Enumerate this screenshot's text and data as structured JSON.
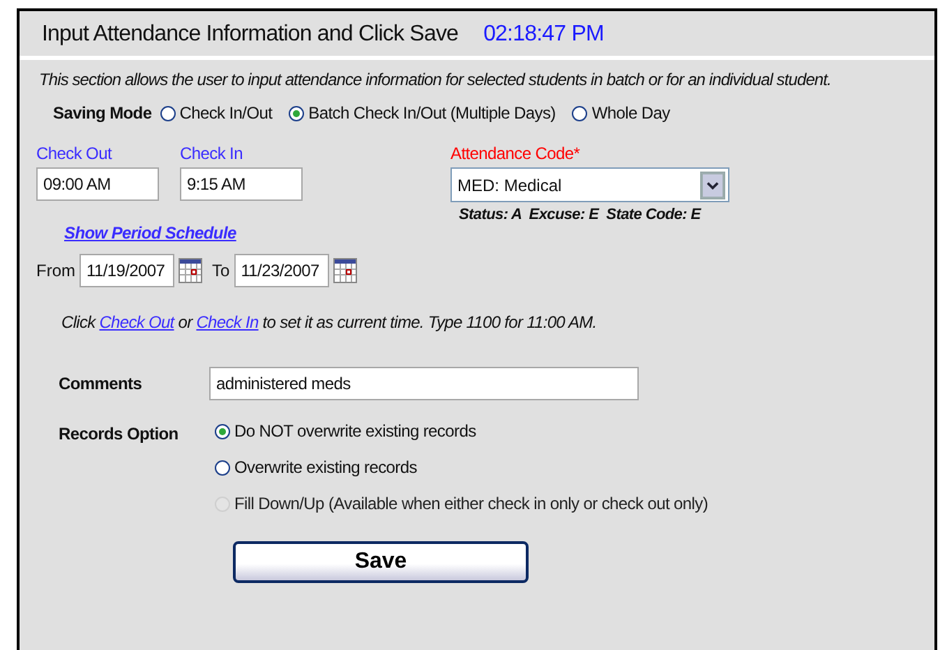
{
  "header": {
    "title": "Input Attendance Information and Click Save",
    "time": "02:18:47 PM"
  },
  "description": "This section allows the user to input attendance information for selected students in batch or for an individual student.",
  "saving_mode": {
    "label": "Saving Mode",
    "options": [
      {
        "label": "Check In/Out",
        "selected": false
      },
      {
        "label": "Batch Check In/Out (Multiple Days)",
        "selected": true
      },
      {
        "label": "Whole Day",
        "selected": false
      }
    ]
  },
  "check_out": {
    "label": "Check Out",
    "value": "09:00 AM"
  },
  "check_in": {
    "label": "Check In",
    "value": "9:15 AM"
  },
  "attendance_code": {
    "label": "Attendance Code*",
    "value": "MED: Medical",
    "details": "Status: A  Excuse: E  State Code: E"
  },
  "period_link": "Show Period Schedule",
  "date_range": {
    "from_label": "From",
    "from": "11/19/2007",
    "to_label": "To",
    "to": "11/23/2007"
  },
  "hint": {
    "before": "Click",
    "link1": "Check Out",
    "middle": "or",
    "link2": "Check In",
    "after": "to set it as current time. Type 1100 for 11:00 AM."
  },
  "comments": {
    "label": "Comments",
    "value": "administered meds"
  },
  "records_option": {
    "label": "Records Option",
    "options": [
      {
        "label": "Do NOT overwrite existing records",
        "selected": true,
        "disabled": false
      },
      {
        "label": "Overwrite existing records",
        "selected": false,
        "disabled": false
      },
      {
        "label": "Fill Down/Up (Available when either check in only or check out only)",
        "selected": false,
        "disabled": true
      }
    ]
  },
  "save_button": "Save"
}
